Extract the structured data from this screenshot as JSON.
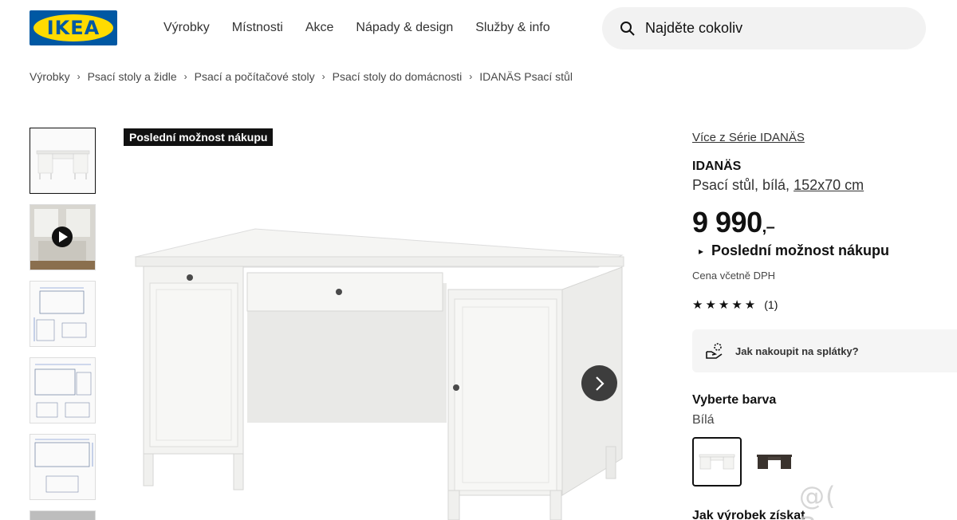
{
  "header": {
    "logo_text": "IKEA",
    "nav": [
      "Výrobky",
      "Místnosti",
      "Akce",
      "Nápady & design",
      "Služby & info"
    ],
    "search_placeholder": "Najděte cokoliv"
  },
  "breadcrumb": [
    "Výrobky",
    "Psací stoly a židle",
    "Psací a počítačové stoly",
    "Psací stoly do domácnosti",
    "IDANÄS Psací stůl"
  ],
  "gallery": {
    "badge": "Poslední možnost nákupu",
    "thumbnails": [
      "product-front",
      "video-room",
      "dimensions-1",
      "dimensions-2",
      "dimensions-3",
      "more"
    ]
  },
  "product": {
    "series_link": "Více z Série IDANÄS",
    "name": "IDANÄS",
    "description": "Psací stůl, bílá,",
    "dimensions": "152x70 cm",
    "price": "9 990",
    "price_suffix": ",–",
    "last_chance": "Poslední možnost nákupu",
    "vat_note": "Cena včetně DPH",
    "stars": "★★★★★",
    "rating_count": "(1)",
    "installment": "Jak nakoupit na splátky?",
    "color_title": "Vyberte barva",
    "color_value": "Bílá",
    "colors": [
      {
        "name": "white",
        "hex": "#f4f4f2"
      },
      {
        "name": "dark-brown",
        "hex": "#3a332e"
      }
    ],
    "how_to_get": "Jak výrobek získat"
  },
  "watermark": "@( Bazos.cz"
}
